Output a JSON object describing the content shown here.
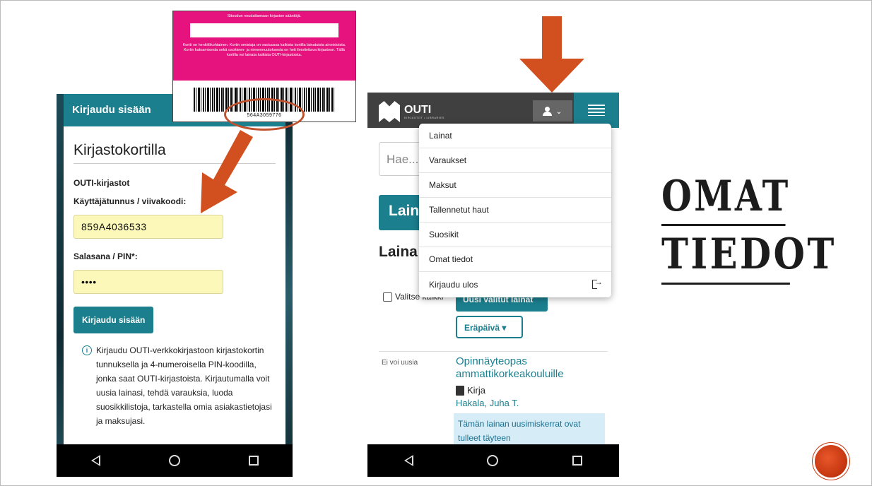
{
  "card": {
    "top_text": "Sitoudun noudattamaan kirjaston sääntöjä.",
    "body_text": "Kortti on henkilökohtainen. Kortin omistaja on vastuussa kaikista kortilla lainatuista aineistoista. Kortin katoamisesta sekä osoitteen- ja nimenmuutoksesta on heti ilmoitettava kirjastoon. Tällä kortilla voi lainata kaikista OUTI-kirjastoista.",
    "barcode_number": "564A3059776"
  },
  "login": {
    "header": "Kirjaudu sisään",
    "title": "Kirjastokortilla",
    "org": "OUTI-kirjastot",
    "username_label": "Käyttäjätunnus / viivakoodi:",
    "username_value": "859A4036533",
    "password_label": "Salasana / PIN*:",
    "password_value": "••••",
    "submit_label": "Kirjaudu sisään",
    "info_text": "Kirjaudu OUTI-verkkokirjastoon kirjastokortin tunnuksella ja 4-numeroisella PIN-koodilla, jonka saat OUTI-kirjastoista. Kirjautumalla voit uusia lainasi, tehdä varauksia, luoda suosikkilistoja, tarkastella omia asiakastietojasi ja maksujasi."
  },
  "library": {
    "logo_text": "OUTI",
    "logo_sub": "KIRJASTOT • LIBRARIES",
    "search_placeholder": "Hae...",
    "teal_button": "Lain",
    "section_heading": "Laina",
    "select_all": "Valitse kaikki",
    "renew_button": "Uusi valitut lainat",
    "sort_button": "Eräpäivä ▾",
    "loan_status": "Ei voi uusia",
    "loan_title": "Opinnäyteopas ammattikorkeakouluille",
    "loan_type": "Kirja",
    "loan_author": "Hakala, Juha T.",
    "loan_alert": "Tämän lainan uusimiskerrat ovat tulleet täyteen"
  },
  "menu": {
    "items": [
      "Lainat",
      "Varaukset",
      "Maksut",
      "Tallennetut haut",
      "Suosikit",
      "Omat tiedot",
      "Kirjaudu ulos"
    ]
  },
  "slide": {
    "title_line1": "OMAT",
    "title_line2": "TIEDOT"
  },
  "colors": {
    "teal": "#1b7f8e",
    "arrow": "#d2501f",
    "card_pink": "#e6137e",
    "input_yellow": "#fbf8b9"
  }
}
